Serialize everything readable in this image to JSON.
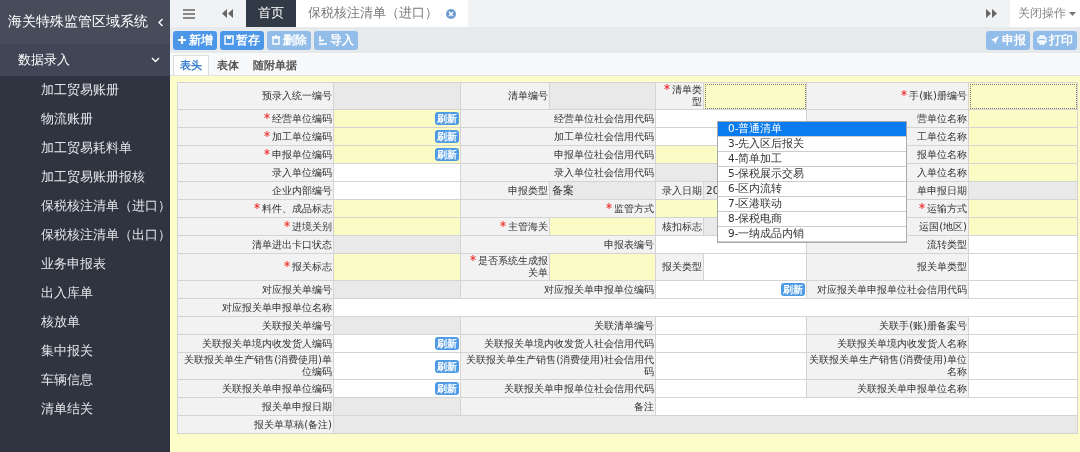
{
  "sidebar": {
    "title": "海关特殊监管区域系统",
    "group": {
      "label": "数据录入",
      "expanded": true
    },
    "items": [
      {
        "label": "加工贸易账册"
      },
      {
        "label": "物流账册"
      },
      {
        "label": "加工贸易耗料单"
      },
      {
        "label": "加工贸易账册报核"
      },
      {
        "label": "保税核注清单（进口）"
      },
      {
        "label": "保税核注清单（出口）"
      },
      {
        "label": "业务申报表"
      },
      {
        "label": "出入库单"
      },
      {
        "label": "核放单"
      },
      {
        "label": "集中报关"
      },
      {
        "label": "车辆信息"
      },
      {
        "label": "清单结关"
      }
    ]
  },
  "tabs": [
    {
      "label": "首页",
      "selected": true,
      "closable": false
    },
    {
      "label": "保税核注清单（进口）",
      "selected": false,
      "closable": true
    }
  ],
  "close_menu": "关闭操作",
  "toolbar": {
    "left": [
      {
        "kind": "add",
        "label": "新增",
        "disabled": false
      },
      {
        "kind": "save",
        "label": "暂存",
        "disabled": false
      },
      {
        "kind": "delete",
        "label": "删除",
        "disabled": true
      },
      {
        "kind": "import",
        "label": "导入",
        "disabled": true
      }
    ],
    "right": [
      {
        "kind": "send",
        "label": "申报",
        "disabled": true
      },
      {
        "kind": "print",
        "label": "打印",
        "disabled": true
      }
    ]
  },
  "subtabs": [
    {
      "label": "表头",
      "selected": true
    },
    {
      "label": "表体",
      "selected": false
    },
    {
      "label": "随附单据",
      "selected": false
    }
  ],
  "form": {
    "rows": [
      {
        "fields": [
          {
            "label": "预录入统一编号",
            "required": false,
            "input": {
              "mandatory": false,
              "readonly": true,
              "focused": false
            }
          },
          {
            "label": "清单编号",
            "required": false,
            "input": {
              "mandatory": false,
              "readonly": true,
              "focused": false
            }
          },
          {
            "label": "清单类型",
            "required": true,
            "input": {
              "mandatory": true,
              "readonly": false,
              "focused": true,
              "open": true,
              "options": [
                {
                  "label": "0-普通清单",
                  "selected": true
                },
                {
                  "label": "3-先入区后报关",
                  "selected": false
                },
                {
                  "label": "4-简单加工",
                  "selected": false
                },
                {
                  "label": "5-保税展示交易",
                  "selected": false
                },
                {
                  "label": "6-区内流转",
                  "selected": false
                },
                {
                  "label": "7-区港联动",
                  "selected": false
                },
                {
                  "label": "8-保税电商",
                  "selected": false
                },
                {
                  "label": "9-一纳成品内销",
                  "selected": false
                }
              ]
            }
          },
          {
            "label": "手(账)册编号",
            "required": true,
            "input": {
              "mandatory": true,
              "readonly": false,
              "focused": true
            }
          }
        ]
      },
      {
        "fields": [
          {
            "label": "经营单位编码",
            "required": true,
            "input": {
              "mandatory": true,
              "readonly": false,
              "focused": false,
              "refresh": "刷新"
            }
          },
          {
            "label": "经营单位社会信用代码",
            "required": false,
            "input": {
              "mandatory": false,
              "readonly": false,
              "focused": false
            }
          },
          {
            "label": "营单位名称",
            "required": false,
            "input": {
              "mandatory": true,
              "readonly": false,
              "focused": false
            }
          }
        ]
      },
      {
        "fields": [
          {
            "label": "加工单位编码",
            "required": true,
            "input": {
              "mandatory": true,
              "readonly": false,
              "focused": false,
              "refresh": "刷新"
            }
          },
          {
            "label": "加工单位社会信用代码",
            "required": false,
            "input": {
              "mandatory": false,
              "readonly": false,
              "focused": false
            }
          },
          {
            "label": "工单位名称",
            "required": false,
            "input": {
              "mandatory": true,
              "readonly": false,
              "focused": false
            }
          }
        ]
      },
      {
        "fields": [
          {
            "label": "申报单位编码",
            "required": true,
            "input": {
              "mandatory": true,
              "readonly": false,
              "focused": false,
              "refresh": "刷新"
            }
          },
          {
            "label": "申报单位社会信用代码",
            "required": false,
            "input": {
              "mandatory": true,
              "readonly": false,
              "focused": false
            }
          },
          {
            "label": "报单位名称",
            "required": false,
            "input": {
              "mandatory": true,
              "readonly": false,
              "focused": false
            }
          }
        ]
      },
      {
        "fields": [
          {
            "label": "录入单位编码",
            "required": false,
            "input": {
              "mandatory": false,
              "readonly": false,
              "focused": false
            }
          },
          {
            "label": "录入单位社会信用代码",
            "required": false,
            "input": {
              "mandatory": false,
              "readonly": true,
              "focused": false
            }
          },
          {
            "label": "入单位名称",
            "required": false,
            "input": {
              "mandatory": true,
              "readonly": false,
              "focused": false
            }
          }
        ]
      },
      {
        "fields": [
          {
            "label": "企业内部编号",
            "required": false,
            "input": {
              "mandatory": false,
              "readonly": false,
              "focused": false
            }
          },
          {
            "label": "申报类型",
            "required": false,
            "input": {
              "mandatory": false,
              "readonly": true,
              "focused": false,
              "value": "备案"
            }
          },
          {
            "label": "录入日期",
            "required": false,
            "input": {
              "mandatory": false,
              "readonly": true,
              "focused": false,
              "value": "20"
            }
          },
          {
            "label": "单申报日期",
            "required": false,
            "input": {
              "mandatory": false,
              "readonly": true,
              "focused": false
            }
          }
        ]
      },
      {
        "fields": [
          {
            "label": "料件、成品标志",
            "required": true,
            "input": {
              "mandatory": true,
              "readonly": false,
              "focused": false
            }
          },
          {
            "label": "监管方式",
            "required": true,
            "input": {
              "mandatory": true,
              "readonly": false,
              "focused": false
            }
          },
          {
            "label": "运输方式",
            "required": true,
            "input": {
              "mandatory": true,
              "readonly": false,
              "focused": false
            }
          }
        ]
      },
      {
        "fields": [
          {
            "label": "进境关别",
            "required": true,
            "input": {
              "mandatory": true,
              "readonly": false,
              "focused": false
            }
          },
          {
            "label": "主管海关",
            "required": true,
            "input": {
              "mandatory": true,
              "readonly": false,
              "focused": false
            }
          },
          {
            "label": "核扣标志",
            "required": false,
            "input": {
              "mandatory": false,
              "readonly": true,
              "focused": false
            }
          },
          {
            "label": "运国(地区)",
            "required": false,
            "input": {
              "mandatory": true,
              "readonly": false,
              "focused": false
            }
          }
        ]
      },
      {
        "fields": [
          {
            "label": "清单进出卡口状态",
            "required": false,
            "input": {
              "mandatory": false,
              "readonly": true,
              "focused": false
            }
          },
          {
            "label": "申报表编号",
            "required": false,
            "input": {
              "mandatory": false,
              "readonly": false,
              "focused": false
            }
          },
          {
            "label": "流转类型",
            "required": false,
            "input": {
              "mandatory": false,
              "readonly": false,
              "focused": false
            }
          }
        ]
      },
      {
        "fields": [
          {
            "label": "报关标志",
            "required": true,
            "input": {
              "mandatory": true,
              "readonly": false,
              "focused": false
            }
          },
          {
            "label": "是否系统生成报关单",
            "required": true,
            "input": {
              "mandatory": true,
              "readonly": false,
              "focused": false
            }
          },
          {
            "label": "报关类型",
            "required": false,
            "input": {
              "mandatory": false,
              "readonly": false,
              "focused": false
            }
          },
          {
            "label": "报关单类型",
            "required": false,
            "input": {
              "mandatory": false,
              "readonly": false,
              "focused": false
            }
          }
        ]
      },
      {
        "fields": [
          {
            "label": "对应报关单编号",
            "required": false,
            "input": {
              "mandatory": false,
              "readonly": true,
              "focused": false
            }
          },
          {
            "label": "对应报关单申报单位编码",
            "required": false,
            "input": {
              "mandatory": false,
              "readonly": false,
              "focused": false,
              "refresh": "刷新"
            }
          },
          {
            "label": "对应报关单申报单位社会信用代码",
            "required": false,
            "input": {
              "mandatory": false,
              "readonly": false,
              "focused": false
            }
          }
        ]
      },
      {
        "fields": [
          {
            "label": "对应报关单申报单位名称",
            "required": false,
            "input": {
              "mandatory": false,
              "readonly": false,
              "focused": false
            }
          }
        ]
      },
      {
        "fields": [
          {
            "label": "关联报关单编号",
            "required": false,
            "input": {
              "mandatory": false,
              "readonly": true,
              "focused": false
            }
          },
          {
            "label": "关联清单编号",
            "required": false,
            "input": {
              "mandatory": false,
              "readonly": false,
              "focused": false
            }
          },
          {
            "label": "关联手(账)册备案号",
            "required": false,
            "input": {
              "mandatory": false,
              "readonly": false,
              "focused": false
            }
          }
        ]
      },
      {
        "fields": [
          {
            "label": "关联报关单境内收发货人编码",
            "required": false,
            "input": {
              "mandatory": false,
              "readonly": false,
              "focused": false,
              "refresh": "刷新"
            }
          },
          {
            "label": "关联报关单境内收发货人社会信用代码",
            "required": false,
            "input": {
              "mandatory": false,
              "readonly": false,
              "focused": false
            }
          },
          {
            "label": "关联报关单境内收发货人名称",
            "required": false,
            "input": {
              "mandatory": false,
              "readonly": false,
              "focused": false
            }
          }
        ]
      },
      {
        "fields": [
          {
            "label": "关联报关单生产销售(消费使用)单位编码",
            "required": false,
            "input": {
              "mandatory": false,
              "readonly": false,
              "focused": false,
              "refresh": "刷新"
            }
          },
          {
            "label": "关联报关单生产销售(消费使用)社会信用代码",
            "required": false,
            "input": {
              "mandatory": false,
              "readonly": false,
              "focused": false
            }
          },
          {
            "label": "关联报关单生产销售(消费使用)单位名称",
            "required": false,
            "input": {
              "mandatory": false,
              "readonly": false,
              "focused": false
            }
          }
        ]
      },
      {
        "fields": [
          {
            "label": "关联报关单申报单位编码",
            "required": false,
            "input": {
              "mandatory": false,
              "readonly": false,
              "focused": false,
              "refresh": "刷新"
            }
          },
          {
            "label": "关联报关单申报单位社会信用代码",
            "required": false,
            "input": {
              "mandatory": false,
              "readonly": false,
              "focused": false
            }
          },
          {
            "label": "关联报关单申报单位名称",
            "required": false,
            "input": {
              "mandatory": false,
              "readonly": false,
              "focused": false
            }
          }
        ]
      },
      {
        "fields": [
          {
            "label": "报关单申报日期",
            "required": false,
            "input": {
              "mandatory": false,
              "readonly": true,
              "focused": false
            }
          },
          {
            "label": "备注",
            "required": false,
            "input": {
              "mandatory": false,
              "readonly": false,
              "focused": false
            }
          }
        ]
      },
      {
        "fields": [
          {
            "label": "报关单草稿(备注)",
            "required": false,
            "input": {
              "mandatory": false,
              "readonly": true,
              "focused": false
            }
          }
        ]
      }
    ]
  }
}
